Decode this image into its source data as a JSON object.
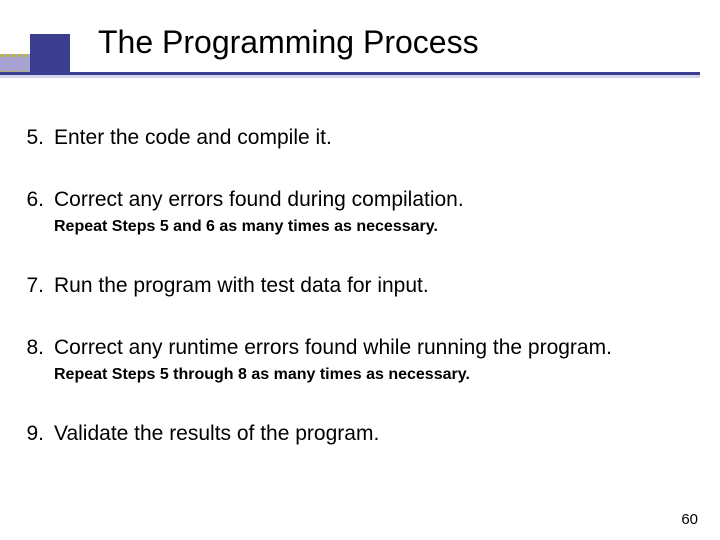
{
  "header": {
    "title": "The Programming Process"
  },
  "items": [
    {
      "num": "5.",
      "text": "Enter the code and compile it.",
      "subnote": null
    },
    {
      "num": "6.",
      "text": "Correct any errors found during compilation.",
      "subnote": "Repeat Steps 5 and 6 as many times as necessary."
    },
    {
      "num": "7.",
      "text": "Run the program with test data for input.",
      "subnote": null
    },
    {
      "num": "8.",
      "text": "Correct any runtime errors found while running the program.",
      "subnote": "Repeat Steps 5 through 8 as many times as necessary."
    },
    {
      "num": "9.",
      "text": "Validate the results of the program.",
      "subnote": null
    }
  ],
  "page_number": "60"
}
